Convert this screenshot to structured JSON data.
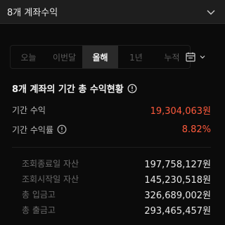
{
  "account_selector": {
    "label": "8개 계좌수익",
    "icon": "chevron-down-icon"
  },
  "period_tabs": [
    {
      "label": "오늘",
      "active": false
    },
    {
      "label": "이번달",
      "active": false
    },
    {
      "label": "올해",
      "active": true
    },
    {
      "label": "1년",
      "active": false
    },
    {
      "label": "누적",
      "active": false
    }
  ],
  "calendar_button": {
    "icon": "calendar-icon"
  },
  "summary": {
    "title": "8개 계좌의 기간 총 수익현황",
    "period_profit_label": "기간 수익",
    "period_profit_value": "19,304,063원",
    "period_return_label": "기간 수익률",
    "period_return_value": "8.82%",
    "details": [
      {
        "label": "조회종료일 자산",
        "value": "197,758,127원"
      },
      {
        "label": "조회시작일 자산",
        "value": "145,230,518원"
      },
      {
        "label": "총 입금고",
        "value": "326,689,002원"
      },
      {
        "label": "총 출금고",
        "value": "293,465,457원"
      }
    ]
  },
  "colors": {
    "accent_red": "#ff5a3c",
    "background": "#0b0b0b"
  }
}
